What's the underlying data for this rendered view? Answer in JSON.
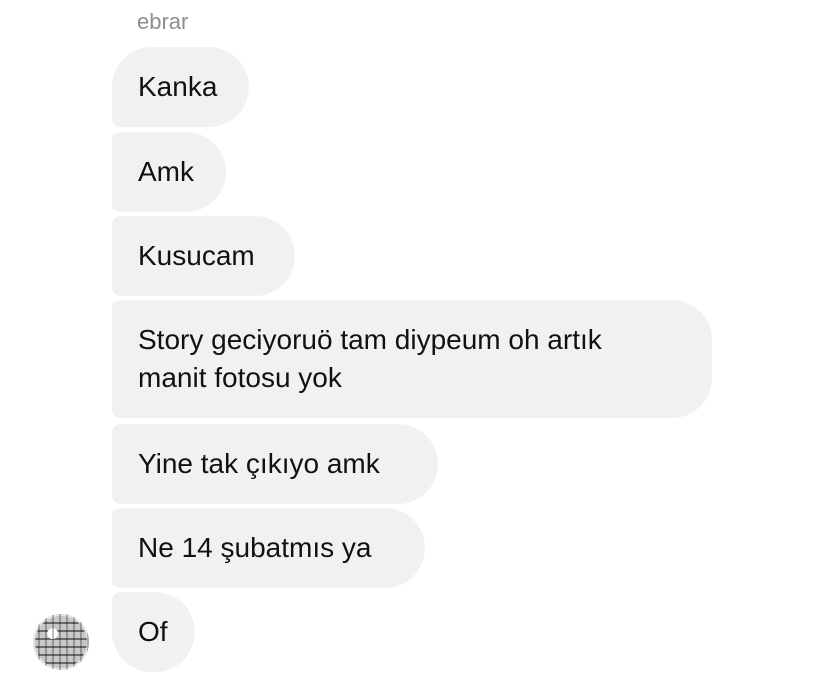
{
  "chat": {
    "sender_name": "ebrar",
    "messages": [
      "Kanka",
      "Amk",
      "Kusucam",
      "Story geciyoruö tam diypeum oh artık\nmanit fotosu yok",
      "Yine tak çıkıyo amk",
      "Ne 14 şubatmıs ya",
      "Of"
    ],
    "avatar_icon": "disco-ball-avatar"
  }
}
